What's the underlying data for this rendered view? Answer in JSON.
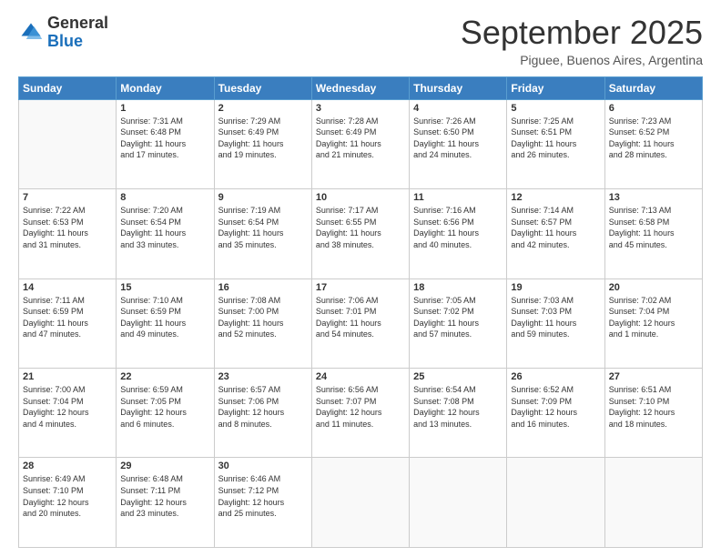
{
  "logo": {
    "general": "General",
    "blue": "Blue"
  },
  "header": {
    "month": "September 2025",
    "location": "Piguee, Buenos Aires, Argentina"
  },
  "days_of_week": [
    "Sunday",
    "Monday",
    "Tuesday",
    "Wednesday",
    "Thursday",
    "Friday",
    "Saturday"
  ],
  "weeks": [
    [
      {
        "day": "",
        "info": ""
      },
      {
        "day": "1",
        "info": "Sunrise: 7:31 AM\nSunset: 6:48 PM\nDaylight: 11 hours\nand 17 minutes."
      },
      {
        "day": "2",
        "info": "Sunrise: 7:29 AM\nSunset: 6:49 PM\nDaylight: 11 hours\nand 19 minutes."
      },
      {
        "day": "3",
        "info": "Sunrise: 7:28 AM\nSunset: 6:49 PM\nDaylight: 11 hours\nand 21 minutes."
      },
      {
        "day": "4",
        "info": "Sunrise: 7:26 AM\nSunset: 6:50 PM\nDaylight: 11 hours\nand 24 minutes."
      },
      {
        "day": "5",
        "info": "Sunrise: 7:25 AM\nSunset: 6:51 PM\nDaylight: 11 hours\nand 26 minutes."
      },
      {
        "day": "6",
        "info": "Sunrise: 7:23 AM\nSunset: 6:52 PM\nDaylight: 11 hours\nand 28 minutes."
      }
    ],
    [
      {
        "day": "7",
        "info": "Sunrise: 7:22 AM\nSunset: 6:53 PM\nDaylight: 11 hours\nand 31 minutes."
      },
      {
        "day": "8",
        "info": "Sunrise: 7:20 AM\nSunset: 6:54 PM\nDaylight: 11 hours\nand 33 minutes."
      },
      {
        "day": "9",
        "info": "Sunrise: 7:19 AM\nSunset: 6:54 PM\nDaylight: 11 hours\nand 35 minutes."
      },
      {
        "day": "10",
        "info": "Sunrise: 7:17 AM\nSunset: 6:55 PM\nDaylight: 11 hours\nand 38 minutes."
      },
      {
        "day": "11",
        "info": "Sunrise: 7:16 AM\nSunset: 6:56 PM\nDaylight: 11 hours\nand 40 minutes."
      },
      {
        "day": "12",
        "info": "Sunrise: 7:14 AM\nSunset: 6:57 PM\nDaylight: 11 hours\nand 42 minutes."
      },
      {
        "day": "13",
        "info": "Sunrise: 7:13 AM\nSunset: 6:58 PM\nDaylight: 11 hours\nand 45 minutes."
      }
    ],
    [
      {
        "day": "14",
        "info": "Sunrise: 7:11 AM\nSunset: 6:59 PM\nDaylight: 11 hours\nand 47 minutes."
      },
      {
        "day": "15",
        "info": "Sunrise: 7:10 AM\nSunset: 6:59 PM\nDaylight: 11 hours\nand 49 minutes."
      },
      {
        "day": "16",
        "info": "Sunrise: 7:08 AM\nSunset: 7:00 PM\nDaylight: 11 hours\nand 52 minutes."
      },
      {
        "day": "17",
        "info": "Sunrise: 7:06 AM\nSunset: 7:01 PM\nDaylight: 11 hours\nand 54 minutes."
      },
      {
        "day": "18",
        "info": "Sunrise: 7:05 AM\nSunset: 7:02 PM\nDaylight: 11 hours\nand 57 minutes."
      },
      {
        "day": "19",
        "info": "Sunrise: 7:03 AM\nSunset: 7:03 PM\nDaylight: 11 hours\nand 59 minutes."
      },
      {
        "day": "20",
        "info": "Sunrise: 7:02 AM\nSunset: 7:04 PM\nDaylight: 12 hours\nand 1 minute."
      }
    ],
    [
      {
        "day": "21",
        "info": "Sunrise: 7:00 AM\nSunset: 7:04 PM\nDaylight: 12 hours\nand 4 minutes."
      },
      {
        "day": "22",
        "info": "Sunrise: 6:59 AM\nSunset: 7:05 PM\nDaylight: 12 hours\nand 6 minutes."
      },
      {
        "day": "23",
        "info": "Sunrise: 6:57 AM\nSunset: 7:06 PM\nDaylight: 12 hours\nand 8 minutes."
      },
      {
        "day": "24",
        "info": "Sunrise: 6:56 AM\nSunset: 7:07 PM\nDaylight: 12 hours\nand 11 minutes."
      },
      {
        "day": "25",
        "info": "Sunrise: 6:54 AM\nSunset: 7:08 PM\nDaylight: 12 hours\nand 13 minutes."
      },
      {
        "day": "26",
        "info": "Sunrise: 6:52 AM\nSunset: 7:09 PM\nDaylight: 12 hours\nand 16 minutes."
      },
      {
        "day": "27",
        "info": "Sunrise: 6:51 AM\nSunset: 7:10 PM\nDaylight: 12 hours\nand 18 minutes."
      }
    ],
    [
      {
        "day": "28",
        "info": "Sunrise: 6:49 AM\nSunset: 7:10 PM\nDaylight: 12 hours\nand 20 minutes."
      },
      {
        "day": "29",
        "info": "Sunrise: 6:48 AM\nSunset: 7:11 PM\nDaylight: 12 hours\nand 23 minutes."
      },
      {
        "day": "30",
        "info": "Sunrise: 6:46 AM\nSunset: 7:12 PM\nDaylight: 12 hours\nand 25 minutes."
      },
      {
        "day": "",
        "info": ""
      },
      {
        "day": "",
        "info": ""
      },
      {
        "day": "",
        "info": ""
      },
      {
        "day": "",
        "info": ""
      }
    ]
  ]
}
